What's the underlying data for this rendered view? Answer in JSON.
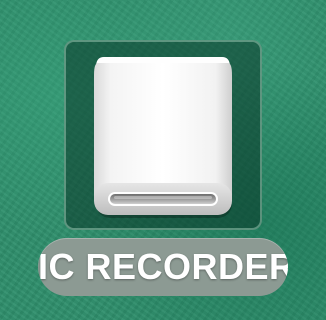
{
  "desktop": {
    "background_color": "#2f8f6c",
    "items": [
      {
        "name": "IC RECORDER",
        "icon": "external-drive-icon",
        "selected": true
      }
    ]
  }
}
